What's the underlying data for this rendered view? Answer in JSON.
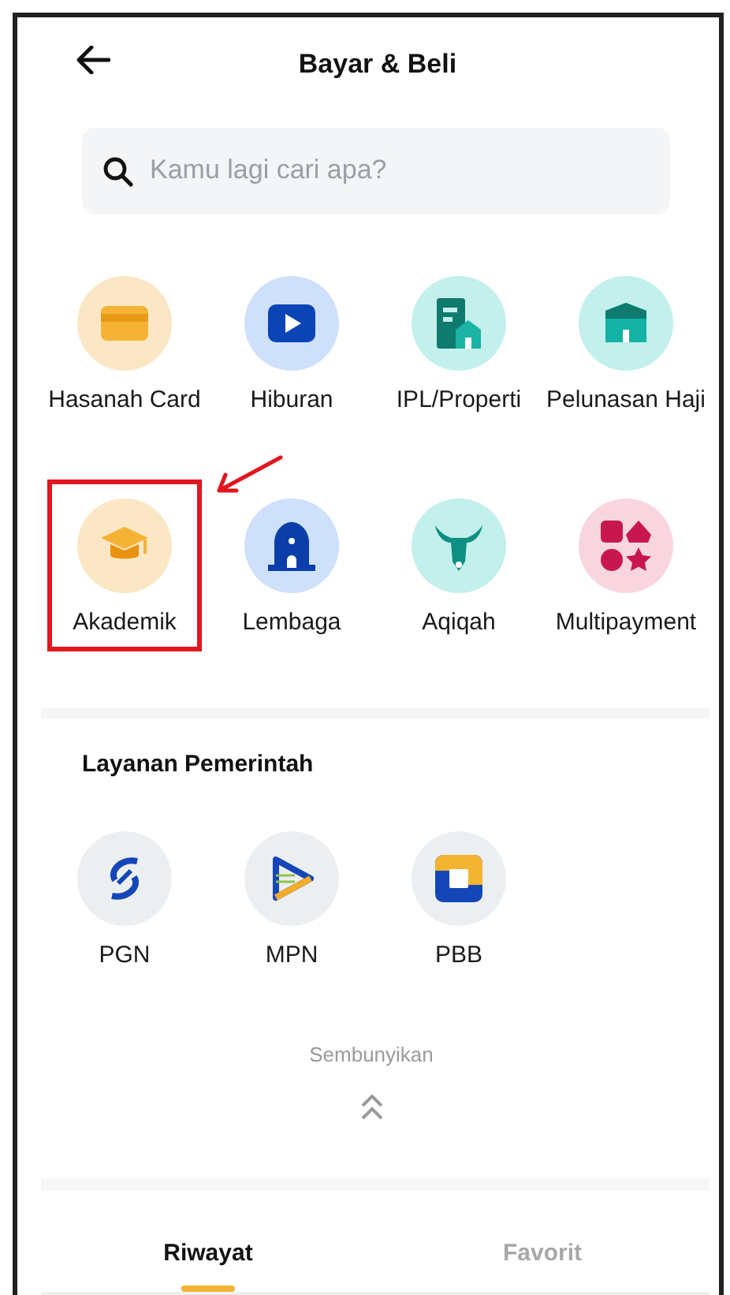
{
  "header": {
    "title": "Bayar & Beli"
  },
  "search": {
    "placeholder": "Kamu lagi cari apa?"
  },
  "menu_items": [
    {
      "label": "Hasanah Card",
      "highlighted": false
    },
    {
      "label": "Hiburan",
      "highlighted": false
    },
    {
      "label": "IPL/Properti",
      "highlighted": false
    },
    {
      "label": "Pelunasan Haji",
      "highlighted": false
    },
    {
      "label": "Akademik",
      "highlighted": true
    },
    {
      "label": "Lembaga",
      "highlighted": false
    },
    {
      "label": "Aqiqah",
      "highlighted": false
    },
    {
      "label": "Multipayment",
      "highlighted": false
    }
  ],
  "government_section": {
    "title": "Layanan Pemerintah",
    "items": [
      {
        "label": "PGN"
      },
      {
        "label": "MPN"
      },
      {
        "label": "PBB"
      }
    ]
  },
  "collapse": {
    "label": "Sembunyikan"
  },
  "tabs": [
    {
      "label": "Riwayat",
      "selected": true
    },
    {
      "label": "Favorit",
      "selected": false
    }
  ]
}
